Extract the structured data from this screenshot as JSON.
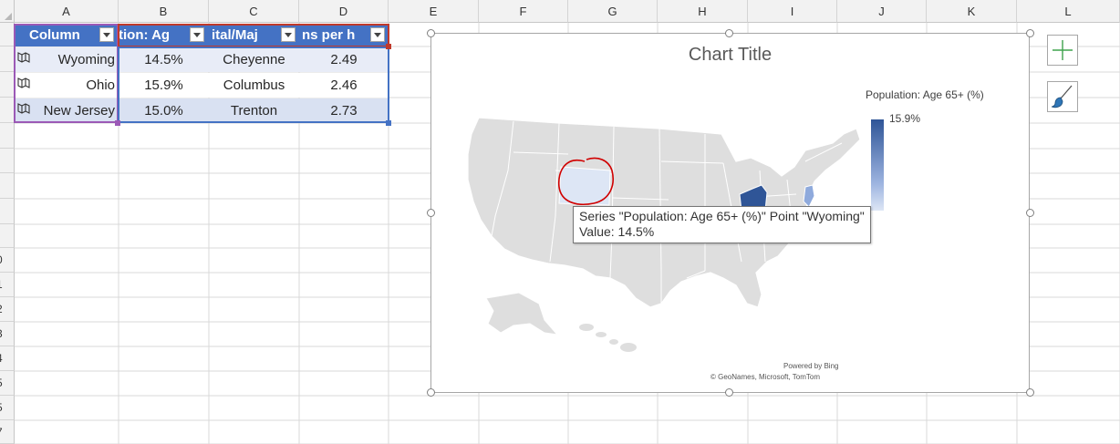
{
  "columns": [
    "A",
    "B",
    "C",
    "D",
    "E",
    "F",
    "G",
    "H",
    "I",
    "J",
    "K",
    "L"
  ],
  "rows": [
    "",
    "",
    "",
    "",
    "",
    "",
    "",
    "",
    "",
    "0",
    "1",
    "2",
    "3",
    "4",
    "5",
    "5",
    "7"
  ],
  "table": {
    "headers": [
      "Column",
      "tion: Ag",
      "ital/Maj",
      "ns per h"
    ],
    "rows": [
      [
        "Wyoming",
        "14.5%",
        "Cheyenne",
        "2.49"
      ],
      [
        "Ohio",
        "15.9%",
        "Columbus",
        "2.46"
      ],
      [
        "New Jersey",
        "15.0%",
        "Trenton",
        "2.73"
      ]
    ]
  },
  "chart": {
    "title": "Chart Title",
    "legend_title": "Population: Age 65+ (%)",
    "legend_max": "15.9%",
    "tooltip_line1": "Series \"Population: Age 65+ (%)\" Point \"Wyoming\"",
    "tooltip_line2": "Value: 14.5%",
    "credit_line1": "Powered by Bing",
    "credit_line2": "© GeoNames, Microsoft, TomTom"
  },
  "chart_data": {
    "type": "table",
    "title": "Chart Title",
    "categories": [
      "Wyoming",
      "Ohio",
      "New Jersey"
    ],
    "series": [
      {
        "name": "Population: Age 65+ (%)",
        "values": [
          14.5,
          15.9,
          15.0
        ]
      }
    ]
  },
  "colors": {
    "table_header": "#4472c4",
    "band": "#d9e1f2",
    "map_land": "#dedede",
    "ohio_fill": "#2f5597",
    "newjersey_fill": "#8faadc",
    "wyoming_fill": "#dde6f5",
    "annotation": "#d00000",
    "chart_elements_icon": "#3fa34d",
    "chart_styles_icon": "#2e75b6"
  },
  "icons": {
    "chart_elements": "plus-icon",
    "chart_styles": "paintbrush-icon",
    "geography": "map-icon"
  }
}
